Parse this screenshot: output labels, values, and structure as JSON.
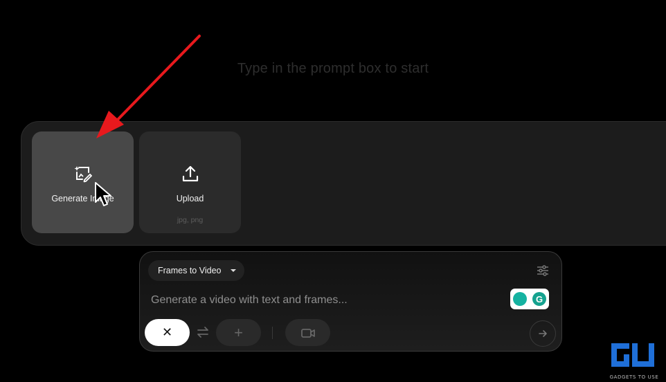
{
  "hint": "Type in the prompt box to start",
  "cards": {
    "generate": {
      "label": "Generate Image",
      "icon": "image-sparkle-icon"
    },
    "upload": {
      "label": "Upload",
      "sub": "jpg, png",
      "icon": "upload-icon"
    }
  },
  "prompt": {
    "mode": "Frames to Video",
    "placeholder": "Generate a video with text and frames...",
    "icons": [
      "settings-sliders-icon",
      "grammarly-icon",
      "close-icon",
      "swap-icon",
      "plus-icon",
      "camera-icon",
      "arrow-right-icon"
    ]
  },
  "colors": {
    "annotation": "#e8191d",
    "grammarly": "#15a28f"
  },
  "watermark": {
    "text": "GADGETS TO USE"
  }
}
